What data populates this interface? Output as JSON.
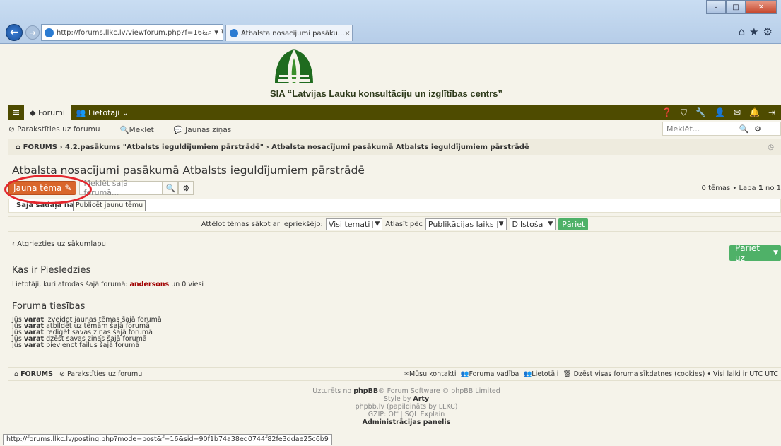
{
  "browser": {
    "url": "http://forums.llkc.lv/viewforum.php?f=16&",
    "tab_title": "Atbalsta nosacījumi pasāku...",
    "tab_close": "×",
    "status_url": "http://forums.llkc.lv/posting.php?mode=post&f=16&sid=90f1b74a38ed0744f82fe3ddae25c6b9"
  },
  "site": {
    "brand": "SIA “Latvijas Lauku konsultāciju un izglītības centrs”"
  },
  "navbar": {
    "forums": "Forumi",
    "users": "Lietotāji"
  },
  "subnav": {
    "subscribe": "Parakstīties uz forumu",
    "search": "Meklēt",
    "new_posts": "Jaunās ziņas",
    "search_placeholder": "Meklēt..."
  },
  "breadcrumb": {
    "root": "FORUMS",
    "mid": "4.2.pasākums \"Atbalsts ieguldījumiem pārstrādē\"",
    "current": "Atbalsta nosacījumi pasākumā Atbalsts ieguldījumiem pārstrādē"
  },
  "page": {
    "title": "Atbalsta nosacījumi pasākumā Atbalsts ieguldījumiem pārstrādē",
    "new_topic": "Jauna tēma",
    "forum_search_placeholder": "Meklēt šajā forumā...",
    "tooltip": "Publicēt jaunu tēmu",
    "notice": "Šajā sadaļā nav",
    "pagecount_prefix": "0 tēmas • Lapa ",
    "pagecount_page": "1",
    "pagecount_suffix": " no 1"
  },
  "sort": {
    "show_label": "Attēlot tēmas sākot ar iepriekšējo:",
    "show_value": "Visi temati",
    "sort_label": "Atlasīt pēc",
    "sort_value": "Publikācijas laiks",
    "dir_value": "Dilstoša",
    "go": "Pāriet"
  },
  "back_link": "Atgriezties uz sākumlapu",
  "jump": "Pāriet uz",
  "online": {
    "heading": "Kas ir Pieslēdzies",
    "text_before": "Lietotāji, kuri atrodas šajā forumā: ",
    "user": "andersons",
    "text_after": " un 0 viesi"
  },
  "perms": {
    "heading": "Foruma tiesības",
    "you": "Jūs",
    "can": "varat",
    "lines": [
      "izveidot jaunas tēmas šajā forumā",
      "atbildēt uz tēmām šajā forumā",
      "rediģēt savas ziņas šajā forumā",
      "dzēst savas ziņas šajā forumā",
      "pievienot failus šajā forumā"
    ]
  },
  "footer": {
    "root": "FORUMS",
    "subscribe": "Parakstīties uz forumu",
    "contact": "Mūsu kontakti",
    "team": "Foruma vadība",
    "members": "Lietotāji",
    "cookies": "Dzēst visas foruma sīkdatnes (cookies)",
    "tz": "• Visi laiki ir UTC UTC"
  },
  "copyright": {
    "line1_a": "Uzturēts no ",
    "line1_b": "phpBB",
    "line1_c": "® Forum Software © phpBB Limited",
    "line2_a": "Style by ",
    "line2_b": "Arty",
    "line3": "phpbb.lv (papildināts by LLKC)",
    "line4": "GZIP: Off | SQL Explain",
    "line5": "Administrācijas panelis"
  }
}
